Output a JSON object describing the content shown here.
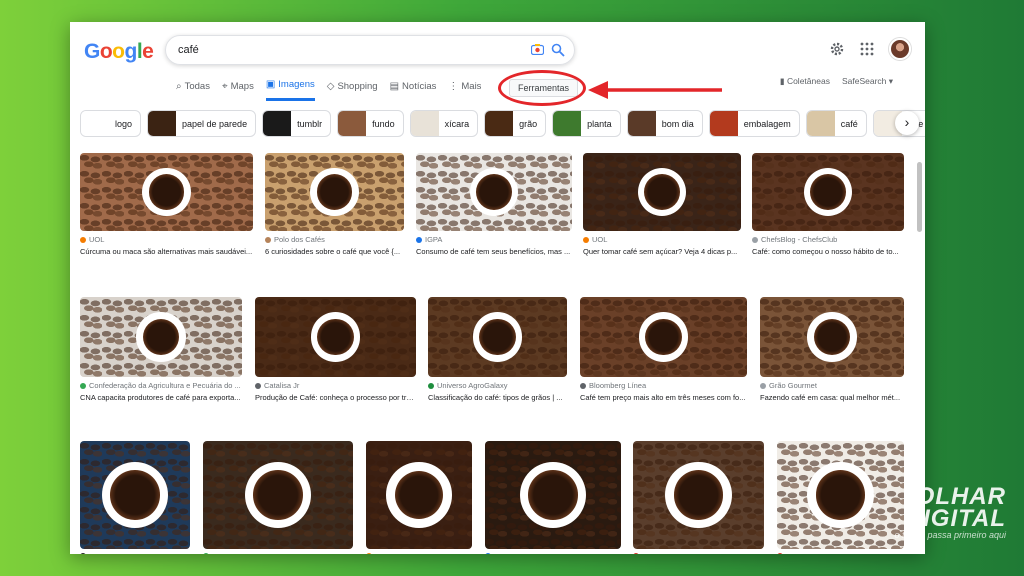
{
  "search": {
    "query": "café"
  },
  "logo": [
    "G",
    "o",
    "o",
    "g",
    "l",
    "e"
  ],
  "logo_colors": [
    "#4285F4",
    "#EA4335",
    "#FBBC05",
    "#4285F4",
    "#34A853",
    "#EA4335"
  ],
  "tabs": [
    {
      "label": "Todas",
      "icon": "magnifier-icon",
      "active": false
    },
    {
      "label": "Maps",
      "icon": "map-pin-icon",
      "active": false
    },
    {
      "label": "Imagens",
      "icon": "image-icon",
      "active": true
    },
    {
      "label": "Shopping",
      "icon": "tag-icon",
      "active": false
    },
    {
      "label": "Notícias",
      "icon": "newspaper-icon",
      "active": false
    },
    {
      "label": "Mais",
      "icon": "more-vert-icon",
      "active": false
    }
  ],
  "tools_label": "Ferramentas",
  "right_links": {
    "collections": "Coletâneas",
    "safesearch": "SafeSearch ▾"
  },
  "chips": [
    {
      "label": "logo",
      "color": "#ffffff"
    },
    {
      "label": "papel de parede",
      "color": "#3b2313"
    },
    {
      "label": "tumblr",
      "color": "#1a1a1a"
    },
    {
      "label": "fundo",
      "color": "#8b5a3c"
    },
    {
      "label": "xícara",
      "color": "#e8e2d8"
    },
    {
      "label": "grão",
      "color": "#4a2a14"
    },
    {
      "label": "planta",
      "color": "#3e7a2e"
    },
    {
      "label": "bom dia",
      "color": "#5a3a28"
    },
    {
      "label": "embalagem",
      "color": "#b33a1e"
    },
    {
      "label": "café",
      "color": "#d9c6a5"
    },
    {
      "label": "arte",
      "color": "#f2ece2"
    }
  ],
  "results": [
    [
      {
        "source": "UOL",
        "caption": "Cúrcuma ou maca são alternativas mais saudávei...",
        "bg": "#a06a4a",
        "dot": "#f57c00"
      },
      {
        "source": "Polo dos Cafés",
        "caption": "6 curiosidades sobre o café que você {...",
        "bg": "#c9a06e",
        "dot": "#b5835a"
      },
      {
        "source": "IGPA",
        "caption": "Consumo de café tem seus benefícios, mas ...",
        "bg": "#e9e6e2",
        "dot": "#1a73e8"
      },
      {
        "source": "UOL",
        "caption": "Quer tomar café sem açúcar? Veja 4 dicas p...",
        "bg": "#3a2418",
        "dot": "#f57c00"
      },
      {
        "source": "ChefsBlog - ChefsClub",
        "caption": "Café: como começou o nosso hábito de to...",
        "bg": "#5a3420",
        "dot": "#9aa0a6"
      }
    ],
    [
      {
        "source": "Confederação da Agricultura e Pecuária do ...",
        "caption": "CNA capacita produtores de café para exporta...",
        "bg": "#d8d2cb",
        "dot": "#34a853"
      },
      {
        "source": "Catalisa Jr",
        "caption": "Produção de Café: conheça o processo por trá...",
        "bg": "#4a2a16",
        "dot": "#5f6368"
      },
      {
        "source": "Universo AgroGalaxy",
        "caption": "Classificação do café: tipos de grãos | ...",
        "bg": "#5c3a22",
        "dot": "#1e8e3e"
      },
      {
        "source": "Bloomberg Línea",
        "caption": "Café tem preço mais alto em três meses com fo...",
        "bg": "#6a4028",
        "dot": "#5f6368"
      },
      {
        "source": "Grão Gourmet",
        "caption": "Fazendo café em casa: qual melhor mét...",
        "bg": "#7a5438",
        "dot": "#9aa0a6"
      }
    ],
    [
      {
        "source": "",
        "caption": "",
        "bg": "#1f3a5a",
        "dot": "#202124"
      },
      {
        "source": "",
        "caption": "",
        "bg": "#3a2a1e",
        "dot": "#34a853"
      },
      {
        "source": "",
        "caption": "",
        "bg": "#3a1f12",
        "dot": "#f57c00"
      },
      {
        "source": "",
        "caption": "",
        "bg": "#2a1a10",
        "dot": "#1a73e8"
      },
      {
        "source": "",
        "caption": "",
        "bg": "#5a3e2c",
        "dot": "#d93025"
      },
      {
        "source": "",
        "caption": "",
        "bg": "#f0ece6",
        "dot": "#d93025"
      }
    ]
  ],
  "watermark": {
    "line1": "OLHAR",
    "line2": "DIGITAL",
    "tagline": "o futuro passa primeiro aqui"
  }
}
